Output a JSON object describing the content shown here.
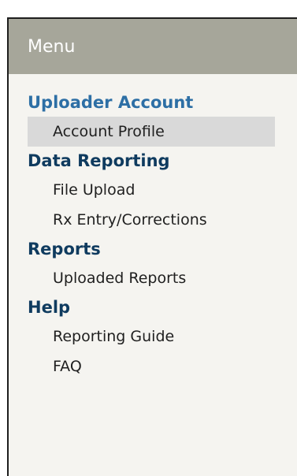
{
  "menu": {
    "title": "Menu",
    "sections": [
      {
        "title": "Uploader Account",
        "items": [
          "Account Profile"
        ]
      },
      {
        "title": "Data Reporting",
        "items": [
          "File Upload",
          "Rx Entry/Corrections"
        ]
      },
      {
        "title": "Reports",
        "items": [
          "Uploaded Reports"
        ]
      },
      {
        "title": "Help",
        "items": [
          "Reporting Guide",
          "FAQ"
        ]
      }
    ],
    "selected_item": "Account Profile",
    "colors": {
      "header_bg": "#a6a69a",
      "panel_bg": "#f5f4f0",
      "active_section": "#2d6fa5",
      "section_text": "#0f3b5f",
      "selected_bg": "#d9d9d9"
    }
  }
}
